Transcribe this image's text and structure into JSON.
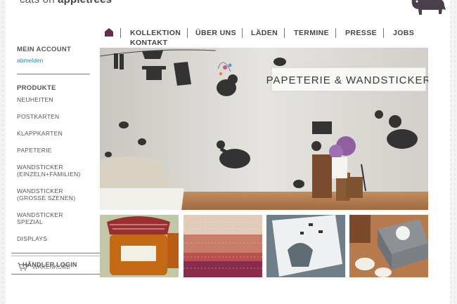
{
  "brand": {
    "logo_prefix": "cats on",
    "logo_name": "appletrees"
  },
  "nav": {
    "items": [
      "KOLLEKTION",
      "ÜBER UNS",
      "LÄDEN",
      "TERMINE",
      "PRESSE",
      "JOBS",
      "KONTAKT"
    ]
  },
  "sidebar": {
    "account_title": "MEIN ACCOUNT",
    "logout_link": "abmelden",
    "products_title": "PRODUKTE",
    "items": [
      "NEUHEITEN",
      "POSTKARTEN",
      "KLAPPKARTEN",
      "PAPETERIE",
      "WANDSTICKER (EINZELN+FAMILIEN)",
      "WANDSTICKER (GROSSE SZENEN)",
      "WANDSTICKER SPEZIAL",
      "DISPLAYS"
    ],
    "dealer_login": "HÄNDLER LOGIN",
    "cart": "WARENKORB"
  },
  "hero": {
    "banner_text": "PAPETERIE & WANDSTICKER"
  },
  "colors": {
    "accent_link": "#2a8a9a",
    "home_icon": "#6b2a4f",
    "text": "#444444"
  }
}
